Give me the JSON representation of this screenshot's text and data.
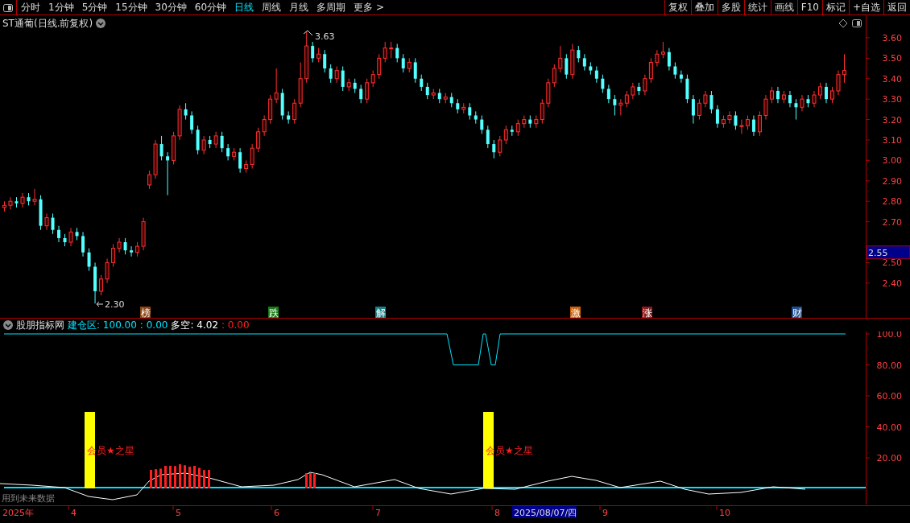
{
  "toolbar": {
    "periods": [
      {
        "label": "分时",
        "selected": false
      },
      {
        "label": "1分钟",
        "selected": false
      },
      {
        "label": "5分钟",
        "selected": false
      },
      {
        "label": "15分钟",
        "selected": false
      },
      {
        "label": "30分钟",
        "selected": false
      },
      {
        "label": "60分钟",
        "selected": false
      },
      {
        "label": "日线",
        "selected": true
      },
      {
        "label": "周线",
        "selected": false
      },
      {
        "label": "月线",
        "selected": false
      },
      {
        "label": "多周期",
        "selected": false
      },
      {
        "label": "更多 >",
        "selected": false
      }
    ],
    "buttons": [
      "复权",
      "叠加",
      "多股",
      "统计",
      "画线",
      "F10",
      "标记",
      "+自选",
      "返回"
    ]
  },
  "chart": {
    "title": "ST通葡(日线.前复权)",
    "high_label": "3.63",
    "low_label": "2.30",
    "chart_data": {
      "type": "candlestick",
      "ylim": [
        2.23,
        3.71
      ],
      "yticks": [
        {
          "value": 3.6,
          "label": "3.60"
        },
        {
          "value": 3.5,
          "label": "3.50"
        },
        {
          "value": 3.4,
          "label": "3.40"
        },
        {
          "value": 3.3,
          "label": "3.30"
        },
        {
          "value": 3.2,
          "label": "3.20"
        },
        {
          "value": 3.1,
          "label": "3.10"
        },
        {
          "value": 3.0,
          "label": "3.00"
        },
        {
          "value": 2.9,
          "label": "2.90"
        },
        {
          "value": 2.8,
          "label": "2.80"
        },
        {
          "value": 2.7,
          "label": "2.70"
        },
        {
          "value": 2.5,
          "label": "2.50"
        },
        {
          "value": 2.4,
          "label": "2.40"
        }
      ],
      "categories": [
        null,
        null,
        null,
        null,
        null,
        null,
        null,
        null,
        null,
        null,
        null,
        null,
        null,
        null,
        null,
        null,
        null,
        null,
        null,
        null,
        null,
        null,
        null,
        null,
        null,
        null,
        null,
        null,
        null,
        null,
        null,
        null,
        null,
        null,
        null,
        null,
        null,
        null,
        null,
        null,
        null,
        null,
        null,
        null,
        null,
        null,
        null,
        null,
        null,
        null,
        null,
        null,
        null,
        null,
        null,
        null,
        null,
        null,
        null,
        null,
        null,
        null,
        null,
        null,
        null,
        null,
        null,
        null,
        null,
        null,
        null,
        null,
        null,
        null,
        null,
        null,
        null,
        null,
        null,
        null,
        null,
        null,
        null,
        null,
        null,
        null,
        null,
        null,
        null,
        null,
        null,
        null,
        null,
        null,
        null,
        null,
        null,
        null,
        null,
        null,
        null,
        null,
        null,
        null,
        null,
        null,
        null,
        null,
        null,
        null,
        null,
        null,
        null,
        null,
        null,
        null,
        null,
        null,
        null,
        null,
        null,
        null,
        null,
        null,
        null,
        null,
        null,
        null,
        null,
        null,
        null,
        null,
        null,
        null,
        null,
        null,
        null,
        null,
        null,
        null
      ],
      "ohlc": [
        [
          2.77,
          2.8,
          2.75,
          2.78
        ],
        [
          2.78,
          2.82,
          2.76,
          2.8
        ],
        [
          2.8,
          2.82,
          2.77,
          2.79
        ],
        [
          2.79,
          2.84,
          2.77,
          2.82
        ],
        [
          2.82,
          2.84,
          2.78,
          2.8
        ],
        [
          2.8,
          2.86,
          2.78,
          2.81
        ],
        [
          2.81,
          2.83,
          2.66,
          2.68
        ],
        [
          2.68,
          2.74,
          2.66,
          2.72
        ],
        [
          2.72,
          2.74,
          2.64,
          2.66
        ],
        [
          2.66,
          2.68,
          2.6,
          2.62
        ],
        [
          2.62,
          2.64,
          2.58,
          2.6
        ],
        [
          2.6,
          2.67,
          2.58,
          2.65
        ],
        [
          2.65,
          2.67,
          2.61,
          2.63
        ],
        [
          2.63,
          2.65,
          2.53,
          2.55
        ],
        [
          2.55,
          2.57,
          2.46,
          2.48
        ],
        [
          2.48,
          2.5,
          2.3,
          2.36
        ],
        [
          2.36,
          2.44,
          2.34,
          2.42
        ],
        [
          2.42,
          2.52,
          2.4,
          2.5
        ],
        [
          2.5,
          2.59,
          2.48,
          2.57
        ],
        [
          2.57,
          2.62,
          2.55,
          2.6
        ],
        [
          2.6,
          2.62,
          2.54,
          2.56
        ],
        [
          2.56,
          2.58,
          2.53,
          2.55
        ],
        [
          2.55,
          2.6,
          2.53,
          2.58
        ],
        [
          2.58,
          2.72,
          2.56,
          2.7
        ],
        [
          2.88,
          2.95,
          2.86,
          2.93
        ],
        [
          2.93,
          3.1,
          2.91,
          3.08
        ],
        [
          3.08,
          3.12,
          3.0,
          3.02
        ],
        [
          3.02,
          3.04,
          2.83,
          3.0
        ],
        [
          3.0,
          3.14,
          2.98,
          3.12
        ],
        [
          3.12,
          3.27,
          3.1,
          3.25
        ],
        [
          3.25,
          3.28,
          3.2,
          3.22
        ],
        [
          3.22,
          3.24,
          3.13,
          3.15
        ],
        [
          3.15,
          3.17,
          3.03,
          3.05
        ],
        [
          3.05,
          3.12,
          3.03,
          3.1
        ],
        [
          3.1,
          3.12,
          3.06,
          3.08
        ],
        [
          3.08,
          3.14,
          3.06,
          3.12
        ],
        [
          3.12,
          3.14,
          3.04,
          3.06
        ],
        [
          3.06,
          3.08,
          3.0,
          3.02
        ],
        [
          3.02,
          3.06,
          3.0,
          3.04
        ],
        [
          3.04,
          3.06,
          2.94,
          2.96
        ],
        [
          2.96,
          3.0,
          2.94,
          2.98
        ],
        [
          2.98,
          3.08,
          2.96,
          3.06
        ],
        [
          3.06,
          3.16,
          3.04,
          3.14
        ],
        [
          3.14,
          3.22,
          3.12,
          3.2
        ],
        [
          3.2,
          3.32,
          3.18,
          3.3
        ],
        [
          3.3,
          3.45,
          3.28,
          3.33
        ],
        [
          3.33,
          3.35,
          3.2,
          3.22
        ],
        [
          3.22,
          3.24,
          3.18,
          3.2
        ],
        [
          3.2,
          3.3,
          3.18,
          3.28
        ],
        [
          3.28,
          3.48,
          3.26,
          3.4
        ],
        [
          3.4,
          3.63,
          3.38,
          3.56
        ],
        [
          3.56,
          3.58,
          3.48,
          3.5
        ],
        [
          3.5,
          3.55,
          3.48,
          3.52
        ],
        [
          3.52,
          3.54,
          3.43,
          3.45
        ],
        [
          3.45,
          3.47,
          3.38,
          3.4
        ],
        [
          3.4,
          3.46,
          3.38,
          3.44
        ],
        [
          3.44,
          3.46,
          3.34,
          3.36
        ],
        [
          3.36,
          3.4,
          3.34,
          3.38
        ],
        [
          3.38,
          3.4,
          3.33,
          3.35
        ],
        [
          3.35,
          3.37,
          3.28,
          3.3
        ],
        [
          3.3,
          3.4,
          3.28,
          3.38
        ],
        [
          3.38,
          3.44,
          3.36,
          3.42
        ],
        [
          3.42,
          3.52,
          3.4,
          3.5
        ],
        [
          3.5,
          3.58,
          3.48,
          3.55
        ],
        [
          3.55,
          3.58,
          3.5,
          3.55
        ],
        [
          3.55,
          3.57,
          3.48,
          3.5
        ],
        [
          3.5,
          3.52,
          3.43,
          3.45
        ],
        [
          3.45,
          3.5,
          3.43,
          3.48
        ],
        [
          3.48,
          3.5,
          3.38,
          3.4
        ],
        [
          3.4,
          3.42,
          3.34,
          3.36
        ],
        [
          3.36,
          3.38,
          3.3,
          3.32
        ],
        [
          3.32,
          3.35,
          3.3,
          3.33
        ],
        [
          3.33,
          3.35,
          3.28,
          3.3
        ],
        [
          3.3,
          3.33,
          3.28,
          3.31
        ],
        [
          3.31,
          3.33,
          3.26,
          3.28
        ],
        [
          3.28,
          3.3,
          3.23,
          3.25
        ],
        [
          3.25,
          3.28,
          3.23,
          3.26
        ],
        [
          3.26,
          3.28,
          3.2,
          3.22
        ],
        [
          3.22,
          3.24,
          3.18,
          3.2
        ],
        [
          3.2,
          3.22,
          3.13,
          3.15
        ],
        [
          3.15,
          3.17,
          3.06,
          3.08
        ],
        [
          3.08,
          3.1,
          3.01,
          3.04
        ],
        [
          3.04,
          3.12,
          3.02,
          3.1
        ],
        [
          3.1,
          3.17,
          3.08,
          3.15
        ],
        [
          3.15,
          3.17,
          3.12,
          3.14
        ],
        [
          3.14,
          3.2,
          3.12,
          3.18
        ],
        [
          3.18,
          3.22,
          3.16,
          3.2
        ],
        [
          3.2,
          3.22,
          3.16,
          3.18
        ],
        [
          3.18,
          3.22,
          3.16,
          3.2
        ],
        [
          3.2,
          3.3,
          3.18,
          3.28
        ],
        [
          3.28,
          3.4,
          3.26,
          3.38
        ],
        [
          3.38,
          3.47,
          3.36,
          3.45
        ],
        [
          3.45,
          3.56,
          3.43,
          3.5
        ],
        [
          3.5,
          3.52,
          3.4,
          3.42
        ],
        [
          3.42,
          3.57,
          3.4,
          3.54
        ],
        [
          3.54,
          3.56,
          3.48,
          3.5
        ],
        [
          3.5,
          3.52,
          3.44,
          3.46
        ],
        [
          3.46,
          3.48,
          3.42,
          3.44
        ],
        [
          3.44,
          3.46,
          3.38,
          3.4
        ],
        [
          3.4,
          3.42,
          3.33,
          3.35
        ],
        [
          3.35,
          3.37,
          3.28,
          3.3
        ],
        [
          3.3,
          3.32,
          3.22,
          3.27
        ],
        [
          3.27,
          3.3,
          3.22,
          3.28
        ],
        [
          3.28,
          3.34,
          3.26,
          3.32
        ],
        [
          3.32,
          3.38,
          3.3,
          3.36
        ],
        [
          3.36,
          3.38,
          3.32,
          3.34
        ],
        [
          3.34,
          3.42,
          3.32,
          3.4
        ],
        [
          3.4,
          3.5,
          3.38,
          3.48
        ],
        [
          3.48,
          3.54,
          3.46,
          3.52
        ],
        [
          3.52,
          3.58,
          3.5,
          3.53
        ],
        [
          3.53,
          3.55,
          3.44,
          3.46
        ],
        [
          3.46,
          3.48,
          3.4,
          3.42
        ],
        [
          3.42,
          3.44,
          3.38,
          3.4
        ],
        [
          3.4,
          3.42,
          3.28,
          3.3
        ],
        [
          3.3,
          3.32,
          3.18,
          3.22
        ],
        [
          3.22,
          3.3,
          3.2,
          3.28
        ],
        [
          3.28,
          3.34,
          3.26,
          3.32
        ],
        [
          3.32,
          3.34,
          3.23,
          3.25
        ],
        [
          3.25,
          3.27,
          3.16,
          3.18
        ],
        [
          3.18,
          3.22,
          3.16,
          3.2
        ],
        [
          3.2,
          3.24,
          3.18,
          3.22
        ],
        [
          3.22,
          3.24,
          3.15,
          3.17
        ],
        [
          3.17,
          3.2,
          3.13,
          3.17
        ],
        [
          3.17,
          3.22,
          3.15,
          3.2
        ],
        [
          3.2,
          3.22,
          3.12,
          3.14
        ],
        [
          3.14,
          3.24,
          3.12,
          3.22
        ],
        [
          3.22,
          3.32,
          3.2,
          3.3
        ],
        [
          3.3,
          3.36,
          3.28,
          3.34
        ],
        [
          3.34,
          3.36,
          3.28,
          3.3
        ],
        [
          3.3,
          3.34,
          3.28,
          3.32
        ],
        [
          3.32,
          3.34,
          3.26,
          3.28
        ],
        [
          3.28,
          3.3,
          3.2,
          3.26
        ],
        [
          3.26,
          3.32,
          3.24,
          3.3
        ],
        [
          3.3,
          3.32,
          3.26,
          3.28
        ],
        [
          3.28,
          3.34,
          3.26,
          3.32
        ],
        [
          3.32,
          3.38,
          3.3,
          3.36
        ],
        [
          3.36,
          3.38,
          3.28,
          3.3
        ],
        [
          3.3,
          3.36,
          3.28,
          3.34
        ],
        [
          3.34,
          3.44,
          3.32,
          3.42
        ],
        [
          3.42,
          3.52,
          3.38,
          3.44
        ]
      ]
    },
    "current_price": "2.55",
    "markers": [
      {
        "label": "榜",
        "color": "#8b4513"
      },
      {
        "label": "跌",
        "color": "#1a7a1a"
      },
      {
        "label": "解",
        "color": "#1a7f86"
      },
      {
        "label": "激",
        "color": "#c8620a"
      },
      {
        "label": "涨",
        "color": "#8b1a1a"
      },
      {
        "label": "财",
        "color": "#1f4f8f"
      }
    ]
  },
  "indicator": {
    "name": "股朋指标网",
    "fields": [
      {
        "label": "建仓区:",
        "value": "100.00",
        "color": "#00e5ff"
      },
      {
        "label": ":",
        "value": "0.00",
        "color": "#00e5ff"
      },
      {
        "label": "多空:",
        "value": "4.02",
        "color": "#ffffff"
      },
      {
        "label": ":",
        "value": "0.00",
        "color": "#ff2020"
      }
    ],
    "axis": [
      "100.0",
      "80.00",
      "60.00",
      "40.00",
      "20.00"
    ],
    "signal_labels": [
      "会员★之星",
      "会员★之星"
    ],
    "note": "用到未来数据"
  },
  "date_axis": {
    "labels": [
      "2025年",
      "4",
      "5",
      "6",
      "7",
      "8",
      "9",
      "10"
    ],
    "cursor_date": "2025/08/07/四"
  }
}
